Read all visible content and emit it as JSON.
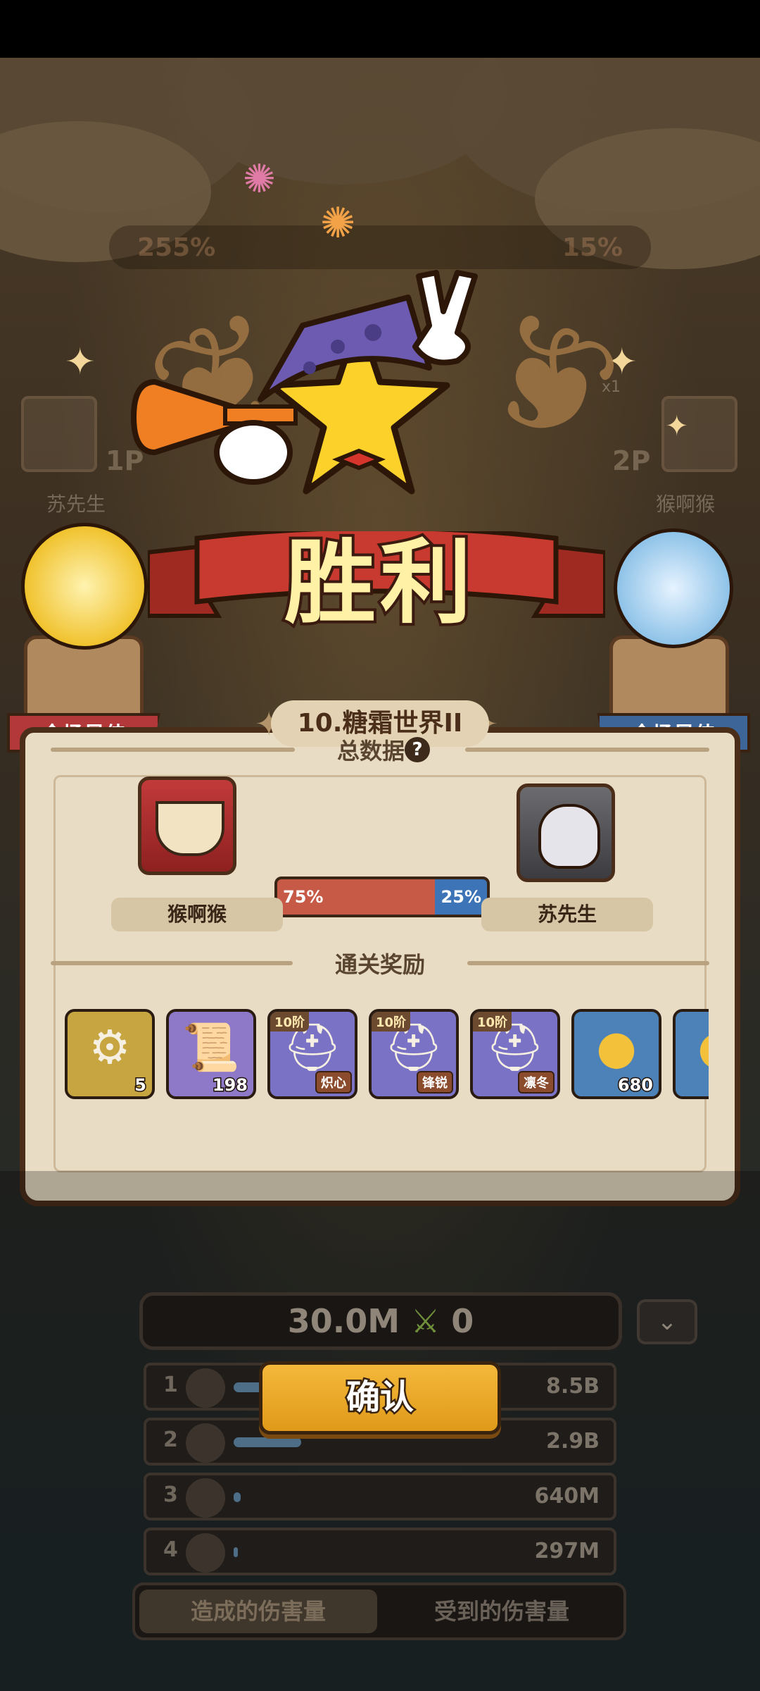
{
  "victory": {
    "title": "胜利"
  },
  "background_hud": {
    "left_stat": "255%",
    "right_stat": "15%",
    "left_tag": "1P",
    "right_tag": "2P",
    "left_name": "苏先生",
    "right_name": "猴啊猴",
    "multiplier": "x1"
  },
  "mvp": {
    "left_label": "全场最佳",
    "right_label": "全场最佳"
  },
  "panel": {
    "level_title": "10.糖霜世界II",
    "stats_header": "总数据",
    "help": "?",
    "player_left": {
      "name": "猴啊猴",
      "percent": "75%",
      "fraction": 0.75
    },
    "player_right": {
      "name": "苏先生",
      "percent": "25%",
      "fraction": 0.25
    },
    "rewards_header": "通关奖励",
    "rewards": [
      {
        "icon": "gear-coins-icon",
        "qty": "5",
        "tier": "",
        "tag": "",
        "color": "#c7a541"
      },
      {
        "icon": "map-scroll-icon",
        "qty": "198",
        "tier": "",
        "tag": "",
        "color": "#8d79c8"
      },
      {
        "icon": "helmet-armor-icon",
        "qty": "",
        "tier": "10阶",
        "tag": "炽心",
        "color": "#7a72c4"
      },
      {
        "icon": "helmet-armor-icon",
        "qty": "",
        "tier": "10阶",
        "tag": "锋锐",
        "color": "#7a72c4"
      },
      {
        "icon": "helmet-armor-icon",
        "qty": "",
        "tier": "10阶",
        "tag": "凛冬",
        "color": "#7a72c4"
      },
      {
        "icon": "gold-coin-icon",
        "qty": "680",
        "tier": "",
        "tag": "",
        "color": "#4d82b8"
      },
      {
        "icon": "gold-coin-icon",
        "qty": "",
        "tier": "",
        "tag": "",
        "color": "#4d82b8"
      }
    ]
  },
  "damage": {
    "total_left": "30.0M",
    "total_right": "0",
    "rows": [
      {
        "rank": "1",
        "value": "8.5B",
        "fill": 0.6
      },
      {
        "rank": "2",
        "value": "2.9B",
        "fill": 0.2
      },
      {
        "rank": "3",
        "value": "640M",
        "fill": 0.02
      },
      {
        "rank": "4",
        "value": "297M",
        "fill": 0.01
      }
    ],
    "tab_dealt": "造成的伤害量",
    "tab_taken": "受到的伤害量"
  },
  "confirm_label": "确认"
}
